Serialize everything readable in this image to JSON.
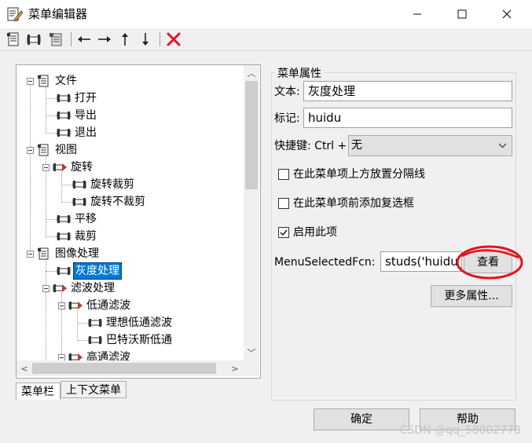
{
  "window": {
    "title": "菜单编辑器",
    "controls": {
      "minimize": "—",
      "maximize": "☐",
      "close": "✕"
    }
  },
  "toolbar": {
    "icons": [
      "new-menu-icon",
      "new-menu-item-icon",
      "new-context-menu-icon",
      "move-left-icon",
      "move-right-icon",
      "move-up-icon",
      "move-down-icon",
      "delete-icon"
    ],
    "delete_color": "#e81123"
  },
  "tree": {
    "items": [
      {
        "label": "文件",
        "level": 0,
        "expanded": true
      },
      {
        "label": "打开",
        "level": 1
      },
      {
        "label": "导出",
        "level": 1
      },
      {
        "label": "退出",
        "level": 1
      },
      {
        "label": "视图",
        "level": 0,
        "expanded": true
      },
      {
        "label": "旋转",
        "level": 1,
        "expanded": true
      },
      {
        "label": "旋转裁剪",
        "level": 2
      },
      {
        "label": "旋转不裁剪",
        "level": 2
      },
      {
        "label": "平移",
        "level": 1
      },
      {
        "label": "裁剪",
        "level": 1
      },
      {
        "label": "图像处理",
        "level": 0,
        "expanded": true
      },
      {
        "label": "灰度处理",
        "level": 1,
        "selected": true
      },
      {
        "label": "滤波处理",
        "level": 1,
        "expanded": true
      },
      {
        "label": "低通滤波",
        "level": 2,
        "expanded": true
      },
      {
        "label": "理想低通滤波",
        "level": 3
      },
      {
        "label": "巴特沃斯低通",
        "level": 3
      },
      {
        "label": "高通滤波",
        "level": 2,
        "expanded": true
      }
    ]
  },
  "tabs": [
    {
      "label": "菜单栏",
      "active": true
    },
    {
      "label": "上下文菜单",
      "active": false
    }
  ],
  "properties": {
    "group_title": "菜单属性",
    "text_label": "文本:",
    "text_value": "灰度处理",
    "tag_label": "标记:",
    "tag_value": "huidu",
    "shortcut_label": "快捷键: Ctrl +",
    "shortcut_value": "无",
    "separator_label": "在此菜单项上方放置分隔线",
    "separator_checked": false,
    "check_label": "在此菜单项前添加复选框",
    "check_checked": false,
    "enable_label": "启用此项",
    "enable_checked": true,
    "callback_label": "MenuSelectedFcn:",
    "callback_value": "studs('huidu_",
    "view_button": "查看",
    "more_button": "更多属性..."
  },
  "footer": {
    "ok": "确定",
    "help": "帮助",
    "watermark": "CSDN @qq_58002778"
  },
  "annotation_color": "#e8101a",
  "selection_color": "#0078d7"
}
